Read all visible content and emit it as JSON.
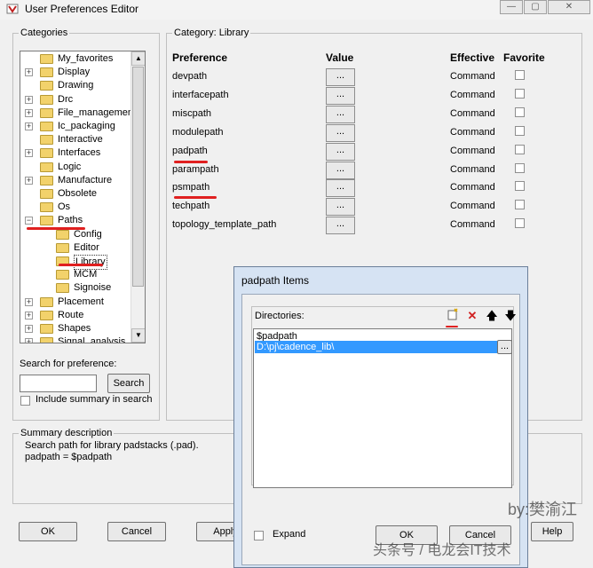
{
  "window": {
    "title": "User Preferences Editor",
    "caption_min": "—",
    "caption_max": "▢",
    "caption_close": "✕"
  },
  "categories": {
    "legend": "Categories",
    "items": [
      {
        "label": "My_favorites",
        "expander": ""
      },
      {
        "label": "Display",
        "expander": "+"
      },
      {
        "label": "Drawing",
        "expander": ""
      },
      {
        "label": "Drc",
        "expander": "+"
      },
      {
        "label": "File_management",
        "expander": "+"
      },
      {
        "label": "Ic_packaging",
        "expander": "+"
      },
      {
        "label": "Interactive",
        "expander": ""
      },
      {
        "label": "Interfaces",
        "expander": "+"
      },
      {
        "label": "Logic",
        "expander": ""
      },
      {
        "label": "Manufacture",
        "expander": "+"
      },
      {
        "label": "Obsolete",
        "expander": ""
      },
      {
        "label": "Os",
        "expander": ""
      },
      {
        "label": "Paths",
        "expander": "−"
      },
      {
        "label": "Config",
        "expander": ""
      },
      {
        "label": "Editor",
        "expander": ""
      },
      {
        "label": "Library",
        "expander": ""
      },
      {
        "label": "MCM",
        "expander": ""
      },
      {
        "label": "Signoise",
        "expander": ""
      },
      {
        "label": "Placement",
        "expander": "+"
      },
      {
        "label": "Route",
        "expander": "+"
      },
      {
        "label": "Shapes",
        "expander": "+"
      },
      {
        "label": "Signal_analysis",
        "expander": "+"
      }
    ],
    "search_label": "Search for preference:",
    "search_value": "",
    "search_button": "Search",
    "include_summary_label": "Include summary in search"
  },
  "category_panel": {
    "legend": "Category:  Library",
    "headers": {
      "preference": "Preference",
      "value": "Value",
      "effective": "Effective",
      "favorite": "Favorite"
    },
    "rows": [
      {
        "name": "devpath",
        "value_btn": "...",
        "effective": "Command"
      },
      {
        "name": "interfacepath",
        "value_btn": "...",
        "effective": "Command"
      },
      {
        "name": "miscpath",
        "value_btn": "...",
        "effective": "Command"
      },
      {
        "name": "modulepath",
        "value_btn": "...",
        "effective": "Command"
      },
      {
        "name": "padpath",
        "value_btn": "...",
        "effective": "Command"
      },
      {
        "name": "parampath",
        "value_btn": "...",
        "effective": "Command"
      },
      {
        "name": "psmpath",
        "value_btn": "...",
        "effective": "Command"
      },
      {
        "name": "techpath",
        "value_btn": "...",
        "effective": "Command"
      },
      {
        "name": "topology_template_path",
        "value_btn": "...",
        "effective": "Command"
      }
    ]
  },
  "summary": {
    "legend": "Summary description",
    "line1": "Search path for library padstacks (.pad).",
    "line2": "padpath = $padpath"
  },
  "bottom_buttons": {
    "ok": "OK",
    "cancel": "Cancel",
    "apply": "Apply",
    "help": "Help"
  },
  "dialog": {
    "title": "padpath Items",
    "directories_label": "Directories:",
    "items": [
      "$padpath",
      "D:\\pj\\cadence_lib\\"
    ],
    "browse": "...",
    "expand_label": "Expand",
    "ok": "OK",
    "cancel": "Cancel"
  },
  "watermark": {
    "byline": "by:樊渝江",
    "footer": "头条号 / 电龙会IT技术"
  },
  "colors": {
    "annotation_red": "#e02020",
    "selection_blue": "#3399ff"
  }
}
